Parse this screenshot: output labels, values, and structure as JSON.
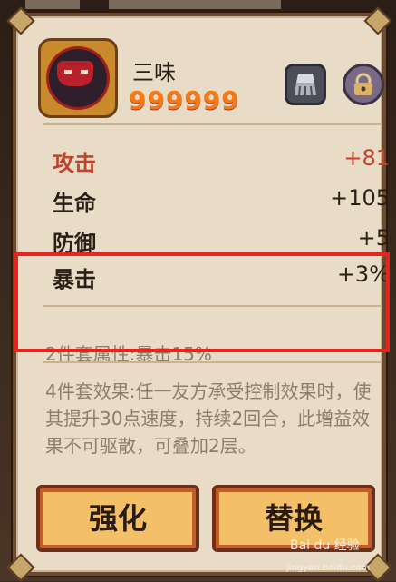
{
  "character": {
    "name": "三味",
    "stars": "999999"
  },
  "icons": {
    "clean": "broom-icon",
    "lock": "lock-icon"
  },
  "stats": [
    {
      "label": "攻击",
      "value": "+81",
      "highlight": true
    },
    {
      "label": "生命",
      "value": "+105",
      "highlight": false
    },
    {
      "label": "防御",
      "value": "+5",
      "highlight": false
    },
    {
      "label": "暴击",
      "value": "+3%",
      "highlight": false
    }
  ],
  "set_bonus": {
    "two_piece": "2件套属性:暴击15%",
    "four_piece": "4件套效果:任一友方承受控制效果时，使其提升30点速度，持续2回合，此增益效果不可驱散，可叠加2层。"
  },
  "buttons": {
    "upgrade": "强化",
    "replace": "替换"
  },
  "watermark": {
    "logo": "Bai du 经验",
    "url": "jingyan.baidu.com"
  },
  "colors": {
    "panel": "#e9dcc6",
    "highlight_text": "#c0442c",
    "annotation_box": "#e8231e",
    "button_fill": "#f3c067"
  }
}
